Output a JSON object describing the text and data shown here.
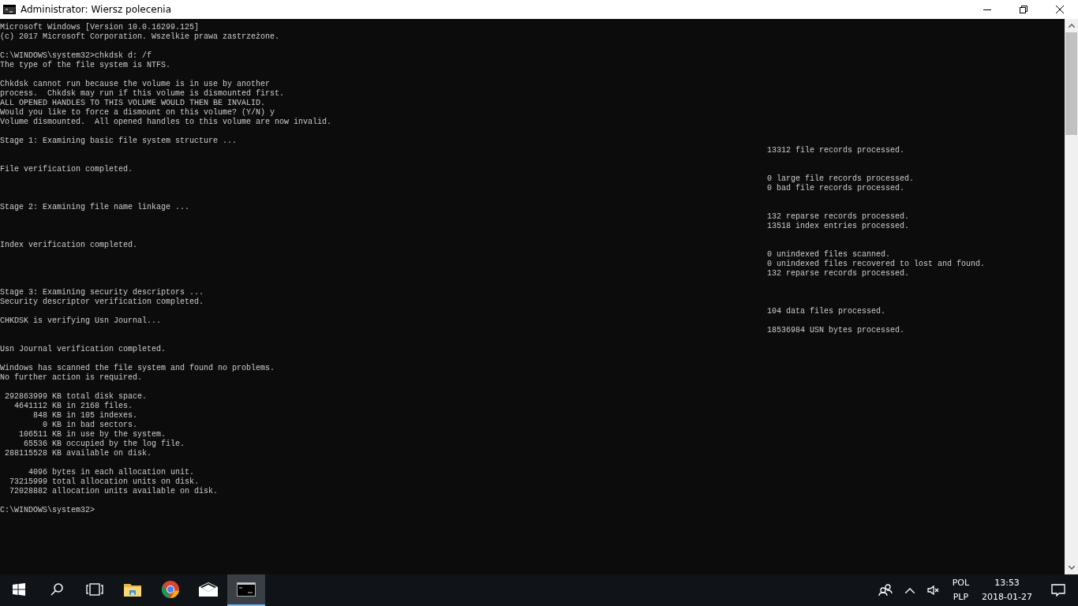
{
  "window": {
    "title": "Administrator: Wiersz polecenia"
  },
  "console": {
    "lines": [
      {
        "kind": "text",
        "text": "Microsoft Windows [Version 10.0.16299.125]"
      },
      {
        "kind": "text",
        "text": "(c) 2017 Microsoft Corporation. Wszelkie prawa zastrzeżone."
      },
      {
        "kind": "blank"
      },
      {
        "kind": "text",
        "text": "C:\\WINDOWS\\system32>chkdsk d: /f"
      },
      {
        "kind": "text",
        "text": "The type of the file system is NTFS."
      },
      {
        "kind": "blank"
      },
      {
        "kind": "text",
        "text": "Chkdsk cannot run because the volume is in use by another"
      },
      {
        "kind": "text",
        "text": "process.  Chkdsk may run if this volume is dismounted first."
      },
      {
        "kind": "text",
        "text": "ALL OPENED HANDLES TO THIS VOLUME WOULD THEN BE INVALID."
      },
      {
        "kind": "text",
        "text": "Would you like to force a dismount on this volume? (Y/N) y"
      },
      {
        "kind": "text",
        "text": "Volume dismounted.  All opened handles to this volume are now invalid."
      },
      {
        "kind": "blank"
      },
      {
        "kind": "text",
        "text": "Stage 1: Examining basic file system structure ..."
      },
      {
        "kind": "aside",
        "text": "13312 file records processed."
      },
      {
        "kind": "blank"
      },
      {
        "kind": "text",
        "text": "File verification completed."
      },
      {
        "kind": "aside",
        "text": "0 large file records processed."
      },
      {
        "kind": "aside",
        "text": "0 bad file records processed."
      },
      {
        "kind": "blank"
      },
      {
        "kind": "text",
        "text": "Stage 2: Examining file name linkage ..."
      },
      {
        "kind": "aside",
        "text": "132 reparse records processed."
      },
      {
        "kind": "aside",
        "text": "13518 index entries processed."
      },
      {
        "kind": "blank"
      },
      {
        "kind": "text",
        "text": "Index verification completed."
      },
      {
        "kind": "aside",
        "text": "0 unindexed files scanned."
      },
      {
        "kind": "aside",
        "text": "0 unindexed files recovered to lost and found."
      },
      {
        "kind": "aside",
        "text": "132 reparse records processed."
      },
      {
        "kind": "blank"
      },
      {
        "kind": "text",
        "text": "Stage 3: Examining security descriptors ..."
      },
      {
        "kind": "text",
        "text": "Security descriptor verification completed."
      },
      {
        "kind": "aside",
        "text": "104 data files processed."
      },
      {
        "kind": "text",
        "text": "CHKDSK is verifying Usn Journal..."
      },
      {
        "kind": "aside",
        "text": "18536984 USN bytes processed."
      },
      {
        "kind": "blank"
      },
      {
        "kind": "text",
        "text": "Usn Journal verification completed."
      },
      {
        "kind": "blank"
      },
      {
        "kind": "text",
        "text": "Windows has scanned the file system and found no problems."
      },
      {
        "kind": "text",
        "text": "No further action is required."
      },
      {
        "kind": "blank"
      },
      {
        "kind": "text",
        "text": " 292863999 KB total disk space."
      },
      {
        "kind": "text",
        "text": "   4641112 KB in 2168 files."
      },
      {
        "kind": "text",
        "text": "       848 KB in 105 indexes."
      },
      {
        "kind": "text",
        "text": "         0 KB in bad sectors."
      },
      {
        "kind": "text",
        "text": "    106511 KB in use by the system."
      },
      {
        "kind": "text",
        "text": "     65536 KB occupied by the log file."
      },
      {
        "kind": "text",
        "text": " 288115528 KB available on disk."
      },
      {
        "kind": "blank"
      },
      {
        "kind": "text",
        "text": "      4096 bytes in each allocation unit."
      },
      {
        "kind": "text",
        "text": "  73215999 total allocation units on disk."
      },
      {
        "kind": "text",
        "text": "  72028882 allocation units available on disk."
      },
      {
        "kind": "blank"
      },
      {
        "kind": "text",
        "text": "C:\\WINDOWS\\system32>"
      }
    ]
  },
  "taskbar": {
    "apps": [
      {
        "kind": "start",
        "selected": false
      },
      {
        "kind": "search",
        "selected": false
      },
      {
        "kind": "taskview",
        "selected": false
      },
      {
        "kind": "folder",
        "selected": false
      },
      {
        "kind": "browser",
        "selected": false
      },
      {
        "kind": "mail",
        "selected": false
      },
      {
        "kind": "terminal",
        "selected": true
      }
    ]
  },
  "tray": {
    "language": "POL",
    "layout": "PLP",
    "time": "13:53",
    "date": "2018-01-27"
  }
}
